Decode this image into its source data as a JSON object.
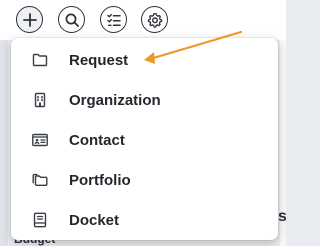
{
  "toolbar": {
    "buttons": [
      {
        "icon": "plus-icon"
      },
      {
        "icon": "search-icon"
      },
      {
        "icon": "task-list-icon"
      },
      {
        "icon": "gear-icon"
      }
    ]
  },
  "menu": {
    "items": [
      {
        "label": "Request",
        "icon": "folder-icon"
      },
      {
        "label": "Organization",
        "icon": "building-icon"
      },
      {
        "label": "Contact",
        "icon": "contact-card-icon"
      },
      {
        "label": "Portfolio",
        "icon": "folders-icon"
      },
      {
        "label": "Docket",
        "icon": "docket-icon"
      }
    ]
  },
  "background": {
    "partial_left_text": "Budget",
    "partial_right_text": "s"
  },
  "annotation": {
    "arrow_color": "#f0962a"
  }
}
